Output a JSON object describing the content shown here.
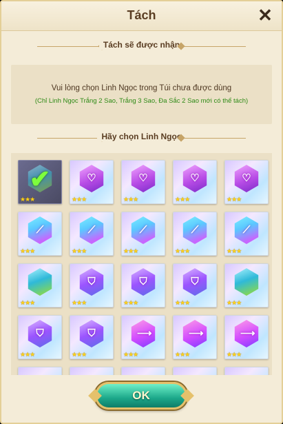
{
  "dialog": {
    "title": "Tách",
    "close_label": "✕"
  },
  "receive_section": {
    "heading": "Tách sẽ được nhận",
    "message": "Vui lòng chọn Linh Ngọc trong Túi chưa được dùng",
    "note": "(Chỉ Linh Ngọc Trắng 2 Sao, Trắng 3 Sao, Đa Sắc 2 Sao mới có thể tách)"
  },
  "select_section": {
    "heading": "Hãy chọn Linh Ngọc"
  },
  "gems": [
    {
      "kind": "selected",
      "emblem": "",
      "stars": "★★★"
    },
    {
      "kind": "purple",
      "emblem": "♡",
      "stars": "★★★"
    },
    {
      "kind": "purple",
      "emblem": "♡",
      "stars": "★★★"
    },
    {
      "kind": "purple",
      "emblem": "♡",
      "stars": "★★★"
    },
    {
      "kind": "purple",
      "emblem": "♡",
      "stars": "★★★"
    },
    {
      "kind": "teal",
      "emblem": "⟋",
      "stars": "★★★"
    },
    {
      "kind": "teal",
      "emblem": "⟋",
      "stars": "★★★"
    },
    {
      "kind": "teal",
      "emblem": "⟋",
      "stars": "★★★"
    },
    {
      "kind": "teal",
      "emblem": "⟋",
      "stars": "★★★"
    },
    {
      "kind": "teal",
      "emblem": "⟋",
      "stars": "★★★"
    },
    {
      "kind": "green",
      "emblem": "",
      "stars": "★★★"
    },
    {
      "kind": "shield",
      "emblem": "⛉",
      "stars": "★★★"
    },
    {
      "kind": "shield",
      "emblem": "⛉",
      "stars": "★★★"
    },
    {
      "kind": "shield",
      "emblem": "⛉",
      "stars": "★★★"
    },
    {
      "kind": "green",
      "emblem": "",
      "stars": "★★★"
    },
    {
      "kind": "shield",
      "emblem": "⛉",
      "stars": "★★★"
    },
    {
      "kind": "shield",
      "emblem": "⛉",
      "stars": "★★★"
    },
    {
      "kind": "pinkarrow",
      "emblem": "⟶",
      "stars": "★★★"
    },
    {
      "kind": "pinkarrow",
      "emblem": "⟶",
      "stars": "★★★"
    },
    {
      "kind": "pinkarrow",
      "emblem": "⟶",
      "stars": "★★★"
    }
  ],
  "ok_button": {
    "label": "OK"
  },
  "colors": {
    "panel": "#f4ecd8",
    "info_note_green": "#2e8a16",
    "button_teal": "#1ca88a",
    "star_gold": "#ffd21a"
  }
}
